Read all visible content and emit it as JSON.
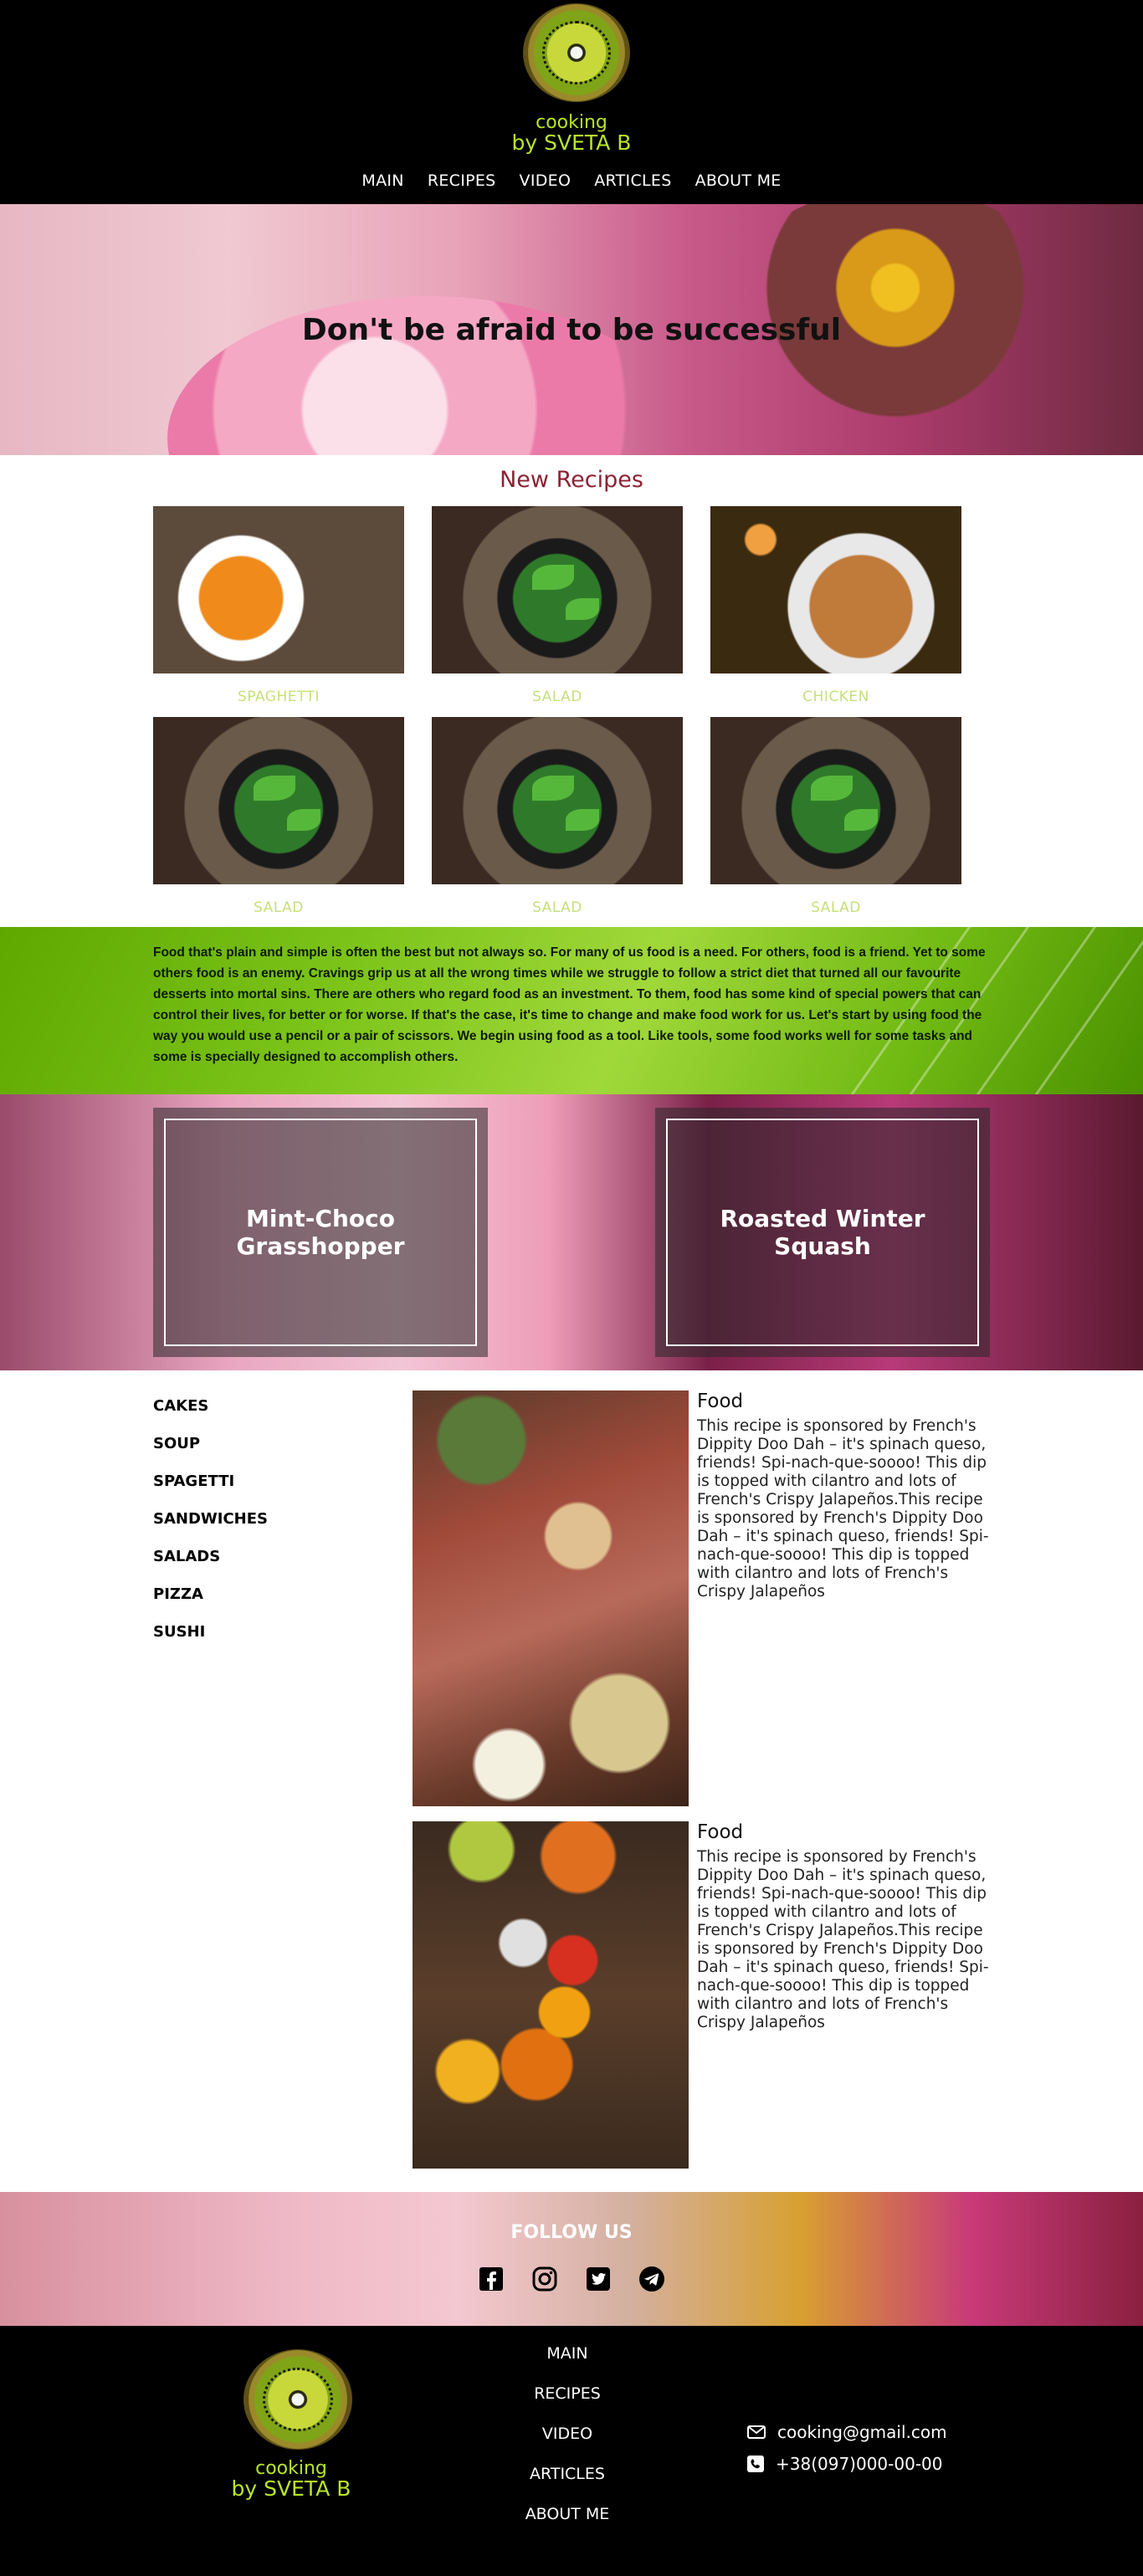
{
  "header": {
    "logo_line1": "cooking",
    "logo_line2": "by SVETA B",
    "nav": [
      "MAIN",
      "RECIPES",
      "VIDEO",
      "ARTICLES",
      "ABOUT ME"
    ]
  },
  "hero": {
    "headline": "Don't be afraid to be successful"
  },
  "new_recipes": {
    "title": "New Recipes",
    "items": [
      "SPAGHETTI",
      "SALAD",
      "CHICKEN",
      "SALAD",
      "SALAD",
      "SALAD"
    ]
  },
  "banner": {
    "text": "Food that's plain and simple is often the best but not always so. For many of us food is a need. For others, food is a friend. Yet to some others food is an enemy. Cravings grip us at all the wrong times while we struggle to follow a strict diet that turned all our favourite desserts into mortal sins. There are others who regard food as an investment. To them, food has some kind of special powers that can control their lives, for better or for worse. If that's the case, it's time to change and make food work for us. Let's start by using food the way you would use a pencil or a pair of scissors. We begin using food as a tool. Like tools, some food works well for some tasks and some is specially designed to accomplish others."
  },
  "featured": [
    "Mint-Choco Grasshopper",
    "Roasted Winter Squash"
  ],
  "categories": [
    "CAKES",
    "SOUP",
    "SPAGETTI",
    "SANDWICHES",
    "SALADS",
    "PIZZA",
    "SUSHI"
  ],
  "articles": [
    {
      "title": "Food",
      "text": "This recipe is sponsored by French's Dippity Doo Dah – it's spinach queso, friends! Spi-nach-que-soooo! This dip is topped with cilantro and lots of French's Crispy Jalapeños.This recipe is sponsored by French's Dippity Doo Dah – it's spinach queso, friends! Spi-nach-que-soooo! This dip is topped with cilantro and lots of French's Crispy Jalapeños"
    },
    {
      "title": "Food",
      "text": "This recipe is sponsored by French's Dippity Doo Dah – it's spinach queso, friends! Spi-nach-que-soooo! This dip is topped with cilantro and lots of French's Crispy Jalapeños.This recipe is sponsored by French's Dippity Doo Dah – it's spinach queso, friends! Spi-nach-que-soooo! This dip is topped with cilantro and lots of French's Crispy Jalapeños"
    }
  ],
  "follow": {
    "title": "FOLLOW US",
    "icons": [
      "facebook-icon",
      "instagram-icon",
      "twitter-icon",
      "telegram-icon"
    ]
  },
  "footer": {
    "logo_line1": "cooking",
    "logo_line2": "by SVETA B",
    "nav": [
      "MAIN",
      "RECIPES",
      "VIDEO",
      "ARTICLES",
      "ABOUT ME"
    ],
    "email": "cooking@gmail.com",
    "phone": "+38(097)000-00-00"
  },
  "colors": {
    "logo_green": "#b8e62a",
    "section_title": "#8b2233",
    "recipe_label": "#c6e07a"
  }
}
